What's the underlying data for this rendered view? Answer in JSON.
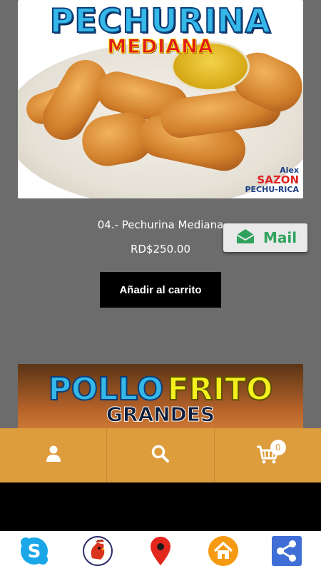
{
  "products": [
    {
      "banner_line1": "PECHURINA",
      "banner_line2": "MEDIANA",
      "brand_small": "Alex",
      "brand_big": "SAZON",
      "brand_tag": "PECHU-RICA",
      "name": "04.- Pechurina Mediana",
      "price": "RD$250.00",
      "add_to_cart_label": "Añadir al carrito"
    },
    {
      "banner_word1": "POLLO",
      "banner_word2": "FRITO",
      "banner_line2": "GRANDES"
    }
  ],
  "mail_button": {
    "label": "Mail",
    "icon": "envelope-icon"
  },
  "bottom_nav": {
    "items": [
      {
        "icon": "user-icon"
      },
      {
        "icon": "search-icon"
      },
      {
        "icon": "cart-icon",
        "badge": "0"
      }
    ],
    "color": "#dd9d3d"
  },
  "app_bar": {
    "icons": [
      "skype-icon",
      "rooster-logo-icon",
      "map-pin-icon",
      "home-icon",
      "share-icon"
    ]
  },
  "colors": {
    "background": "#6c6c6c",
    "nav_orange": "#dd9d3d",
    "mail_green": "#2fa35d",
    "button_black": "#000000"
  }
}
